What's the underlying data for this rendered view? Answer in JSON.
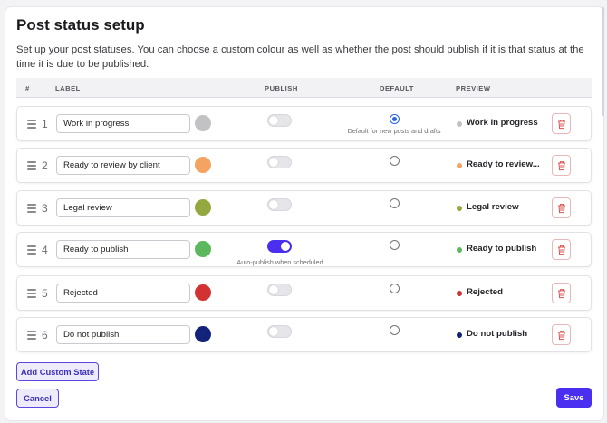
{
  "page": {
    "title": "Post status setup",
    "description": "Set up your post statuses. You can choose a custom colour as well as whether the post should publish if it is that status at the time it is due to be published."
  },
  "table": {
    "headers": {
      "num": "#",
      "label": "LABEL",
      "publish": "PUBLISH",
      "default": "DEFAULT",
      "preview": "PREVIEW"
    },
    "rows": [
      {
        "num": "1",
        "label": "Work in progress",
        "color": "#c2c2c4",
        "publish": false,
        "publish_note": "",
        "default": true,
        "default_note": "Default for new posts and drafts",
        "preview": "Work in progress"
      },
      {
        "num": "2",
        "label": "Ready to review by client",
        "color": "#f4a362",
        "publish": false,
        "publish_note": "",
        "default": false,
        "default_note": "",
        "preview": "Ready to review..."
      },
      {
        "num": "3",
        "label": "Legal review",
        "color": "#93a83e",
        "publish": false,
        "publish_note": "",
        "default": false,
        "default_note": "",
        "preview": "Legal review"
      },
      {
        "num": "4",
        "label": "Ready to publish",
        "color": "#5cb85c",
        "publish": true,
        "publish_note": "Auto-publish when scheduled",
        "default": false,
        "default_note": "",
        "preview": "Ready to publish"
      },
      {
        "num": "5",
        "label": "Rejected",
        "color": "#d23232",
        "publish": false,
        "publish_note": "",
        "default": false,
        "default_note": "",
        "preview": "Rejected"
      },
      {
        "num": "6",
        "label": "Do not publish",
        "color": "#13237a",
        "publish": false,
        "publish_note": "",
        "default": false,
        "default_note": "",
        "preview": "Do not publish"
      }
    ]
  },
  "actions": {
    "add_custom_state": "Add Custom State",
    "cancel": "Cancel",
    "save": "Save"
  },
  "icons": {
    "drag": "drag-handle-icon",
    "delete": "trash-icon"
  },
  "colors": {
    "accent": "#4a2ff0",
    "radio": "#2563eb",
    "delete": "#d9534f"
  }
}
